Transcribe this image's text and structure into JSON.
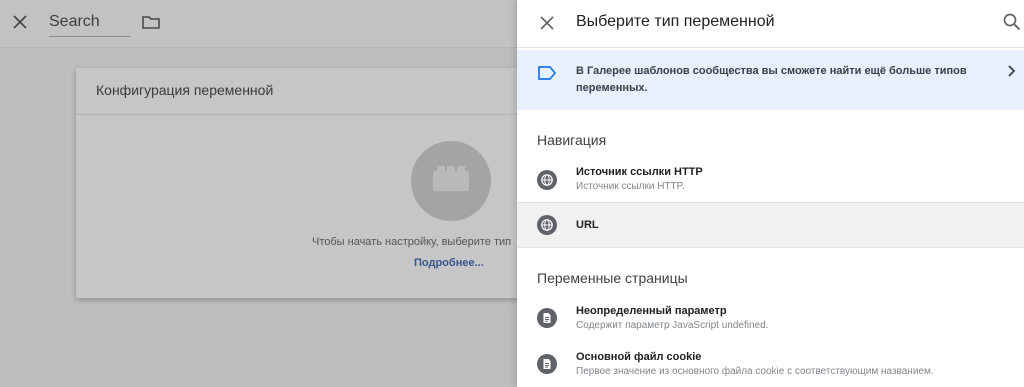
{
  "background": {
    "title": "Search",
    "card_title": "Конфигурация переменной",
    "hint": "Чтобы начать настройку, выберите тип",
    "more_link": "Подробнее..."
  },
  "drawer": {
    "title": "Выберите тип переменной",
    "banner_text": "В Галерее шаблонов сообщества вы сможете найти ещё больше типов переменных.",
    "sections": {
      "navigation": "Навигация",
      "page_variables": "Переменные страницы"
    },
    "items": {
      "http_referrer": {
        "title": "Источник ссылки HTTP",
        "subtitle": "Источник ссылки HTTP."
      },
      "url": {
        "title": "URL"
      },
      "undefined_param": {
        "title": "Неопределенный параметр",
        "subtitle": "Содержит параметр JavaScript undefined."
      },
      "first_party_cookie": {
        "title": "Основной файл cookie",
        "subtitle": "Первое значение из основного файла cookie с соответствующим названием."
      }
    }
  },
  "colors": {
    "banner_bg": "#e8effd",
    "accent_blue": "#1a73e8",
    "icon_grey": "#5f6368",
    "overlay": "#bdbdbd"
  }
}
